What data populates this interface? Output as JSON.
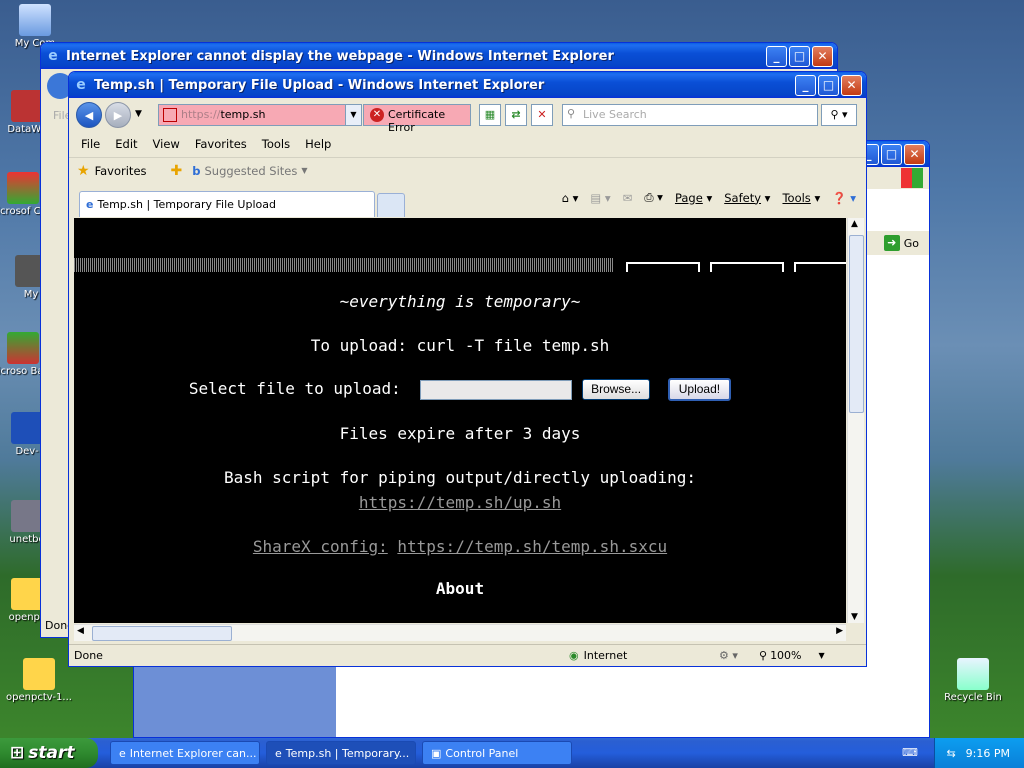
{
  "desktop": {
    "icons": [
      {
        "label": "My Com",
        "icon": "my-computer-icon"
      },
      {
        "label": "DataWa",
        "icon": "shortcut-icon"
      },
      {
        "label": "Microsof C++",
        "icon": "visual-cpp-icon"
      },
      {
        "label": "My",
        "icon": "my-documents-icon"
      },
      {
        "label": "Microso Basic",
        "icon": "visual-basic-icon"
      },
      {
        "label": "Dev-",
        "icon": "dev-cpp-icon"
      },
      {
        "label": "unetbo",
        "icon": "unetbootin-icon"
      },
      {
        "label": "openpc",
        "icon": "file-icon"
      },
      {
        "label": "openpctv-1...",
        "icon": "iso-file-icon"
      },
      {
        "label": "Recycle Bin",
        "icon": "recycle-bin-icon"
      }
    ]
  },
  "bg_windows": {
    "ie_error_title": "Internet Explorer cannot display the webpage - Windows Internet Explorer",
    "ie_error_status": "Done",
    "ie_error_menu_fragment": "File",
    "control_panel_go": "Go"
  },
  "ie": {
    "title": "Temp.sh | Temporary File Upload - Windows Internet Explorer",
    "address_protocol": "https://",
    "address_host": "temp.sh",
    "cert_error": "Certificate Error",
    "search_placeholder": "Live Search",
    "menu": [
      "File",
      "Edit",
      "View",
      "Favorites",
      "Tools",
      "Help"
    ],
    "favorites_label": "Favorites",
    "suggested_sites": "Suggested Sites",
    "tab_title": "Temp.sh | Temporary File Upload",
    "cmd": {
      "page": "Page",
      "safety": "Safety",
      "tools": "Tools"
    },
    "status_text": "Done",
    "zone": "Internet",
    "zoom": "100%"
  },
  "page": {
    "tagline": "~everything is temporary~",
    "upload_instructions": "To upload: curl -T file temp.sh",
    "select_label": "Select file to upload:",
    "browse_button": "Browse...",
    "upload_button": "Upload!",
    "expiry": "Files expire after 3 days",
    "bash_text": "Bash script for piping output/directly uploading:",
    "bash_link": "https://temp.sh/up.sh",
    "sharex_label": "ShareX config:",
    "sharex_link": "https://temp.sh/temp.sh.sxcu",
    "about": "About"
  },
  "taskbar": {
    "start": "start",
    "tasks": [
      "Internet Explorer can...",
      "Temp.sh | Temporary...",
      "Control Panel"
    ],
    "clock": "9:16 PM"
  }
}
